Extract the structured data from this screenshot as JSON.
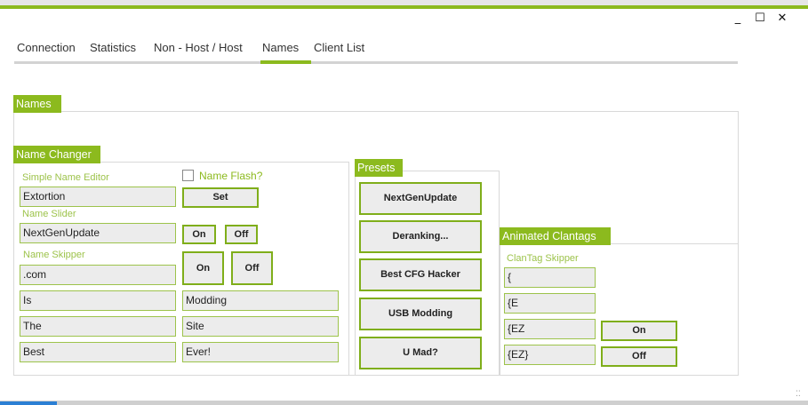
{
  "window": {
    "minimize": "_",
    "maximize": "☐",
    "close": "✕"
  },
  "tabs": [
    "Connection",
    "Statistics",
    "Non - Host / Host",
    "Names",
    "Client List"
  ],
  "active_tab": "Names",
  "names_header": "Names",
  "name_changer": {
    "header": "Name Changer",
    "simple_editor_label": "Simple Name Editor",
    "simple_editor_value": "Extortion",
    "name_flash_label": "Name Flash?",
    "set_button": "Set",
    "slider_label": "Name Slider",
    "slider_value": "NextGenUpdate",
    "slider_on": "On",
    "slider_off": "Off",
    "skipper_label": "Name Skipper",
    "skipper_on": "On",
    "skipper_off": "Off",
    "skipper_fields": [
      ".com",
      "Is",
      "Modding",
      "The",
      "Site",
      "Best",
      "Ever!"
    ]
  },
  "presets": {
    "header": "Presets",
    "buttons": [
      "NextGenUpdate",
      "Deranking...",
      "Best CFG Hacker",
      "USB Modding",
      "U Mad?"
    ]
  },
  "clantags": {
    "header": "Animated Clantags",
    "skipper_label": "ClanTag Skipper",
    "fields": [
      "{",
      "{E",
      "{EZ",
      "{EZ}"
    ],
    "on": "On",
    "off": "Off"
  }
}
